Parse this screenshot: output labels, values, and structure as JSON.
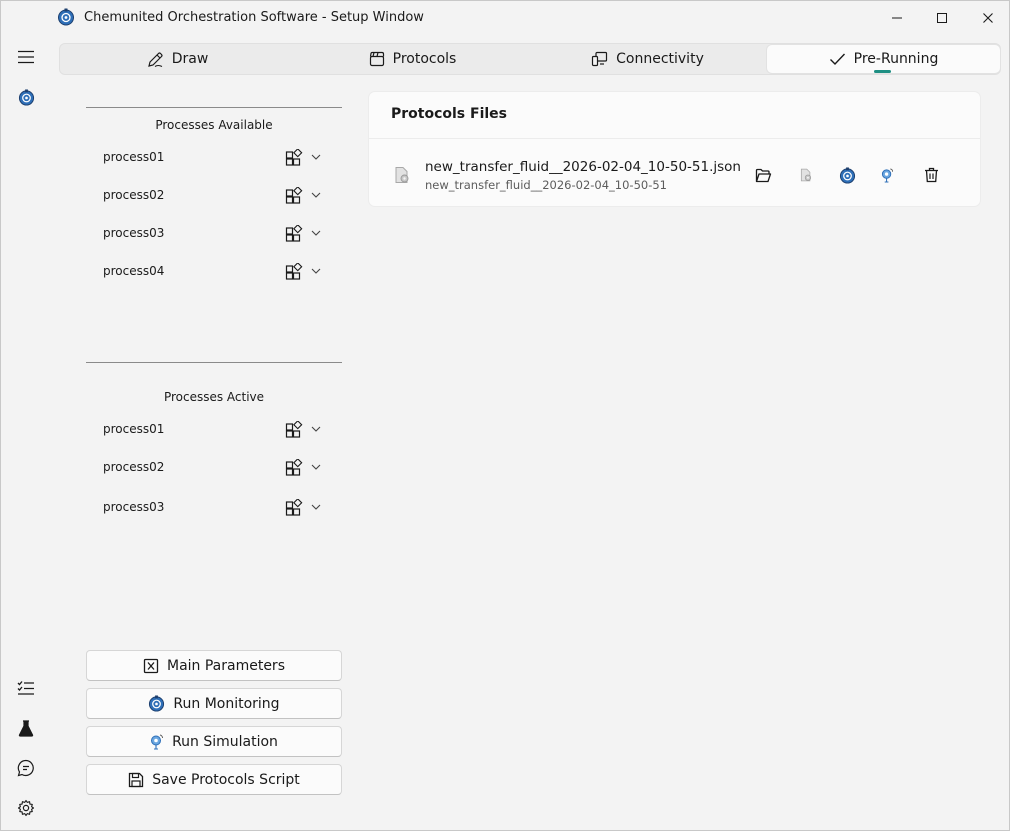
{
  "window": {
    "title": "Chemunited Orchestration Software - Setup Window",
    "icons": [
      "app-logo",
      "minimize-icon",
      "maximize-icon",
      "close-icon"
    ]
  },
  "rail": {
    "top": [
      "menu-icon",
      "app-logo-icon"
    ],
    "bottom": [
      "task-list-icon",
      "flask-icon",
      "chat-icon",
      "gear-icon"
    ]
  },
  "tabs": [
    {
      "label": "Draw",
      "icon": "pen-icon",
      "selected": false
    },
    {
      "label": "Protocols",
      "icon": "clapperboard-icon",
      "selected": false
    },
    {
      "label": "Connectivity",
      "icon": "devices-icon",
      "selected": false
    },
    {
      "label": "Pre-Running",
      "icon": "checkmark-icon",
      "selected": true
    }
  ],
  "available": {
    "header": "Processes Available",
    "items": [
      "process01",
      "process02",
      "process03",
      "process04"
    ]
  },
  "active": {
    "header": "Processes Active",
    "items": [
      "process01",
      "process02",
      "process03"
    ]
  },
  "actions": {
    "main_parameters": "Main Parameters",
    "run_monitoring": "Run Monitoring",
    "run_simulation": "Run Simulation",
    "save_script": "Save Protocols Script"
  },
  "protocols": {
    "title": "Protocols Files",
    "files": [
      {
        "name": "new_transfer_fluid__2026-02-04_10-50-51.json",
        "subtitle": "new_transfer_fluid__2026-02-04_10-50-51",
        "actions": [
          "open-folder-icon",
          "file-settings-icon",
          "monitoring-icon",
          "simulation-icon",
          "delete-icon"
        ]
      }
    ]
  },
  "colors": {
    "accent": "#1e8f83",
    "logo_blue": "#2e6fb8",
    "background": "#f3f3f3",
    "card": "#fbfbfb"
  }
}
